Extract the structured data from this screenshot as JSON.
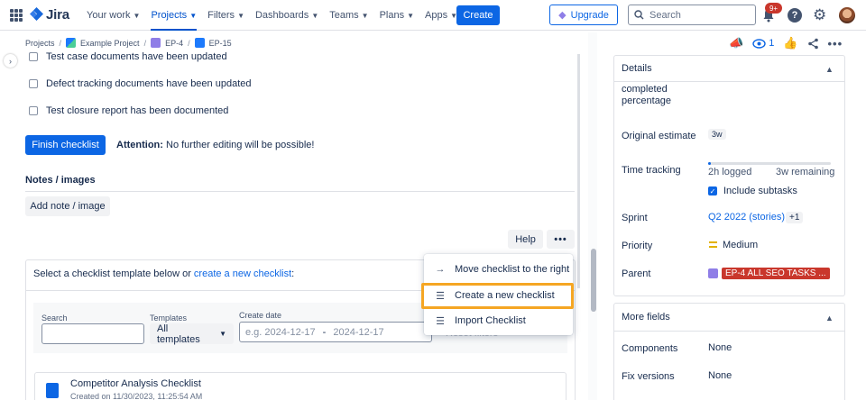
{
  "nav": {
    "logo": "Jira",
    "items": [
      {
        "label": "Your work"
      },
      {
        "label": "Projects"
      },
      {
        "label": "Filters"
      },
      {
        "label": "Dashboards"
      },
      {
        "label": "Teams"
      },
      {
        "label": "Plans"
      },
      {
        "label": "Apps"
      }
    ],
    "create": "Create",
    "upgrade": "Upgrade",
    "search_placeholder": "Search",
    "notification_badge": "9+"
  },
  "breadcrumb": {
    "projects": "Projects",
    "project": "Example Project",
    "epic": "EP-4",
    "issue": "EP-15"
  },
  "checklist": {
    "items": [
      "Test case documents have been updated",
      "Defect tracking documents have been updated",
      "Test closure report has been documented"
    ],
    "finish": "Finish checklist",
    "attention_label": "Attention:",
    "attention_text": "No further editing will be possible!"
  },
  "notes": {
    "title": "Notes / images",
    "add": "Add note / image"
  },
  "toolbar": {
    "help": "Help",
    "more": "•••"
  },
  "template_panel": {
    "prefix": "Select a checklist template below or ",
    "link": "create a new checklist",
    "suffix": ":",
    "search_label": "Search",
    "templates_label": "Templates",
    "templates_value": "All templates",
    "date_label": "Create date",
    "date_from": "e.g. 2024-12-17",
    "date_to": "2024-12-17",
    "date_sep": "-",
    "reset": "Reset filters",
    "card_title": "Competitor Analysis Checklist",
    "card_sub": "Created on 11/30/2023, 11:25:54 AM"
  },
  "menu": {
    "items": [
      {
        "label": "Move checklist to the right",
        "icon": "arrow-right-icon"
      },
      {
        "label": "Create a new checklist",
        "icon": "list-icon"
      },
      {
        "label": "Import Checklist",
        "icon": "list-icon"
      }
    ]
  },
  "issue_actions": {
    "watch_count": "1"
  },
  "details": {
    "title": "Details",
    "completed_label_1": "completed",
    "completed_label_2": "percentage",
    "original_estimate_label": "Original estimate",
    "original_estimate": "3w",
    "time_tracking_label": "Time tracking",
    "logged": "2h logged",
    "remaining": "3w remaining",
    "progress": 0.02,
    "include_subtasks": "Include subtasks",
    "sprint_label": "Sprint",
    "sprint": "Q2 2022 (stories)",
    "sprint_more": "+1",
    "priority_label": "Priority",
    "priority": "Medium",
    "parent_label": "Parent",
    "parent": "EP-4 ALL SEO TASKS ..."
  },
  "more_fields": {
    "title": "More fields",
    "components_label": "Components",
    "components": "None",
    "fix_versions_label": "Fix versions",
    "fix_versions": "None"
  },
  "colors": {
    "primary": "#0c66e4",
    "highlight": "#f5a623",
    "parent_tag": "#c9372c"
  }
}
